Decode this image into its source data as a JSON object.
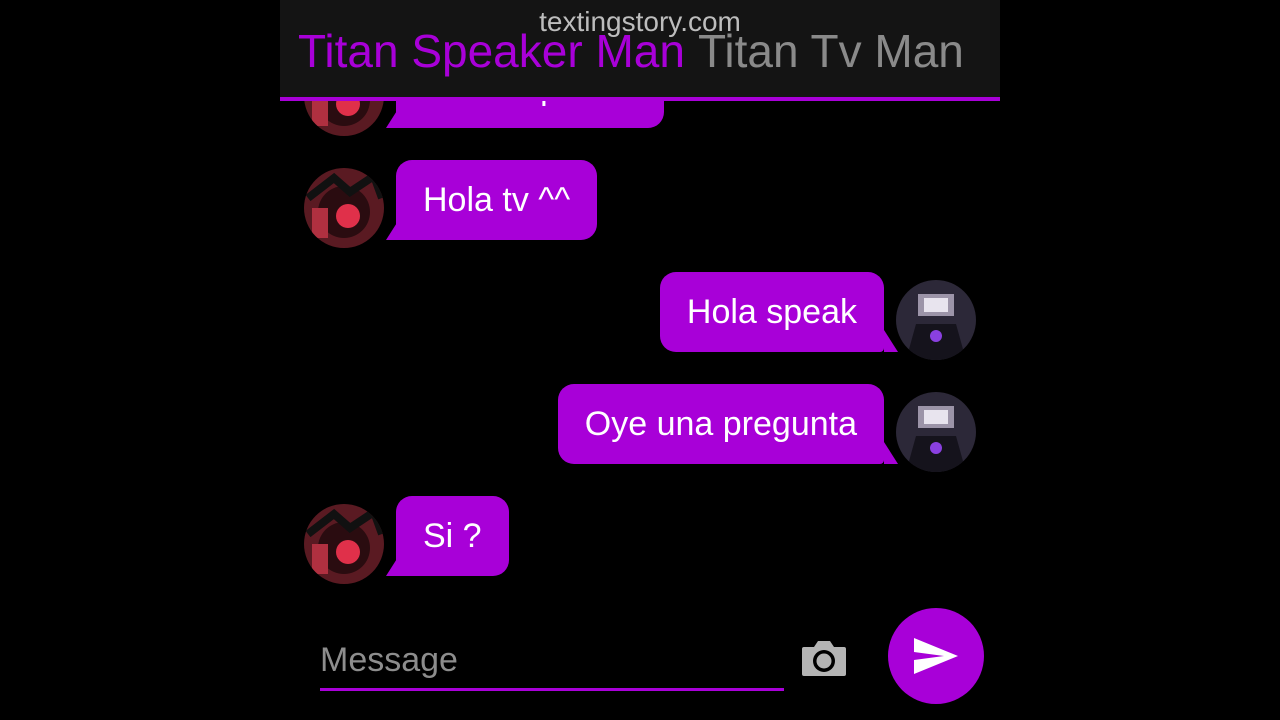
{
  "header": {
    "watermark": "textingstory.com",
    "title_main": "Titan Speaker Man",
    "title_secondary": "Titan Tv Man",
    "accent_color": "#a800d8"
  },
  "messages": [
    {
      "side": "left",
      "text": "Abre la puerta",
      "avatar": "speaker-avatar"
    },
    {
      "side": "left",
      "text": "Hola tv ^^",
      "avatar": "speaker-avatar"
    },
    {
      "side": "right",
      "text": "Hola speak",
      "avatar": "tv-avatar"
    },
    {
      "side": "right",
      "text": "Oye una pregunta",
      "avatar": "tv-avatar"
    },
    {
      "side": "left",
      "text": "Si ?",
      "avatar": "speaker-avatar"
    }
  ],
  "composer": {
    "placeholder": "Message",
    "camera_icon": "camera-icon",
    "send_icon": "send-icon"
  }
}
